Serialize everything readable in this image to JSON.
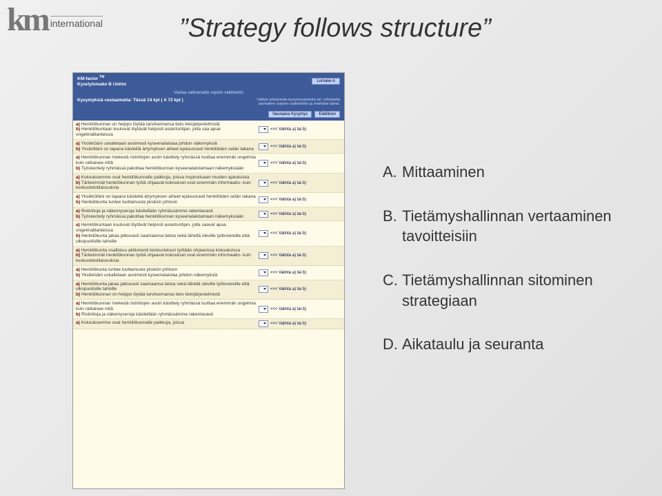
{
  "logo": {
    "km": "km",
    "intl": "international"
  },
  "title": "”Strategy follows structure”",
  "form": {
    "product": "KM-factor",
    "tm": "TM",
    "formName": "Kyselylomake B /Johto",
    "buttonLomake": "Lomake A",
    "counter": "Kysymyksiä vastaamatta: Tässä 14 kpl  ( A 72 kpl )",
    "instr1": "Vastaa valitsemalla sopivin vaihtoehto",
    "instr2": "Valitse jokaisesta kysymysparista tai -ryhmästä parhaiten sopivin vaihtoehto ja merkitse tämä.",
    "navPrev": "Seuraava  Kysymys",
    "navNext": "Edellinen",
    "valintaText": "<<< Valinta  a)  tai  b)",
    "questions": [
      {
        "a": "Henkilökunnan on helppo löytää tarvitsemansa tieto tietojärjestelmistä",
        "b": "Henkilökuntaan kuuluvat löytävät helposti asiantuntijan, jolta saa apua ongelmatilanteissa"
      },
      {
        "a": "Yksikköäni uskalletaan avoimesti kyseenalaistaa johdon näkemyksiä",
        "b": "Yksikölläni on tapana käsitellä ärtymyksen aiheet epäsuorasti henkilöiden selän takana"
      },
      {
        "a": "Henkilökunnan mielestä ristiriitojen avoin käsittely ryhmässä tuottaa enemmän ongelmia kuin ratkaisee niitä",
        "b": "Työskentely ryhmässä pakottaa henkilökunnan kyseenalaistamaan näkemyksiään"
      },
      {
        "a": "Kokouksemme ovat henkilökunnalle paikkoja, joissa inspiroituaan muiden ajatuksista",
        "b": "Tärkeimmät henkilökunnan työtä ohjaavat kokoukset ovat enemmän informaatio- kuin keskustelutilaisuuksia"
      },
      {
        "a": "Yksikkölläni on tapana käsitellä ärtymyksen aiheet epäsuorasti henkilöiden selän takana",
        "b": "Henkilökunta tuntee luottamusta yksikön johtoon"
      },
      {
        "a": "Ristiriitoja ja näkemyseroja käsitellään ryhmässämme rakentavasti",
        "b": "Työskentely ryhmässä pakottaa henkilökunnan kyseenalaistamaan näkemyksiään"
      },
      {
        "a": "Henkilökuntaan kuuluvat löytävät helposti asiantuntijan, jolta saavat apua ongelmatilanteissa",
        "b": "Henkilökunta jakaa jatkuvasti saamaansa tietoa sekä lähellä oleville työtovereille että ulkopuolisille tahoille"
      },
      {
        "a": "Henkilökunta osallistuu aktiivisesti keskusteluun työtään ohjaavissa kokouksissa",
        "b": "Tärkeimmät henkilökunnan työtä ohjaavat kokoukset ovat enemmän informaatio- kuin keskustelutilaisuuksia"
      },
      {
        "a": "Henkilökunta tuntee luottamusta yksikön johtoon",
        "b": "Yksikköäni uskalletaan avoimesti kyseenalaistaa johdon näkemyksiä"
      },
      {
        "a": "Henkilökunta jakaa jatkuvasti saamaansa tietoa sekä lähellä oleville työtovereille että ulkopuolisille tahoille",
        "b": "Henkilökunnan on helppo löytää tarvitsemansa tieto tietojärjestelmistä"
      },
      {
        "a": "Henkilökunnan mielestä ristiriitojen avoin käsittely ryhmässä tuottaa enemmän ongelmia kuin ratkaisee niitä",
        "b": "Ristiriitoja ja näkemyseroja käsitellään ryhmässämme rakentavasti"
      },
      {
        "a": "Kokouksemme ovat henkilökunnalle paikkoja, joissa",
        "b": ""
      }
    ]
  },
  "bullets": [
    {
      "letter": "A.",
      "text": "Mittaaminen"
    },
    {
      "letter": "B.",
      "text": "Tietämyshallinnan vertaaminen tavoitteisiin"
    },
    {
      "letter": "C.",
      "text": "Tietämyshallinnan sitominen strategiaan"
    },
    {
      "letter": "D.",
      "text": "Aikataulu ja seuranta"
    }
  ]
}
